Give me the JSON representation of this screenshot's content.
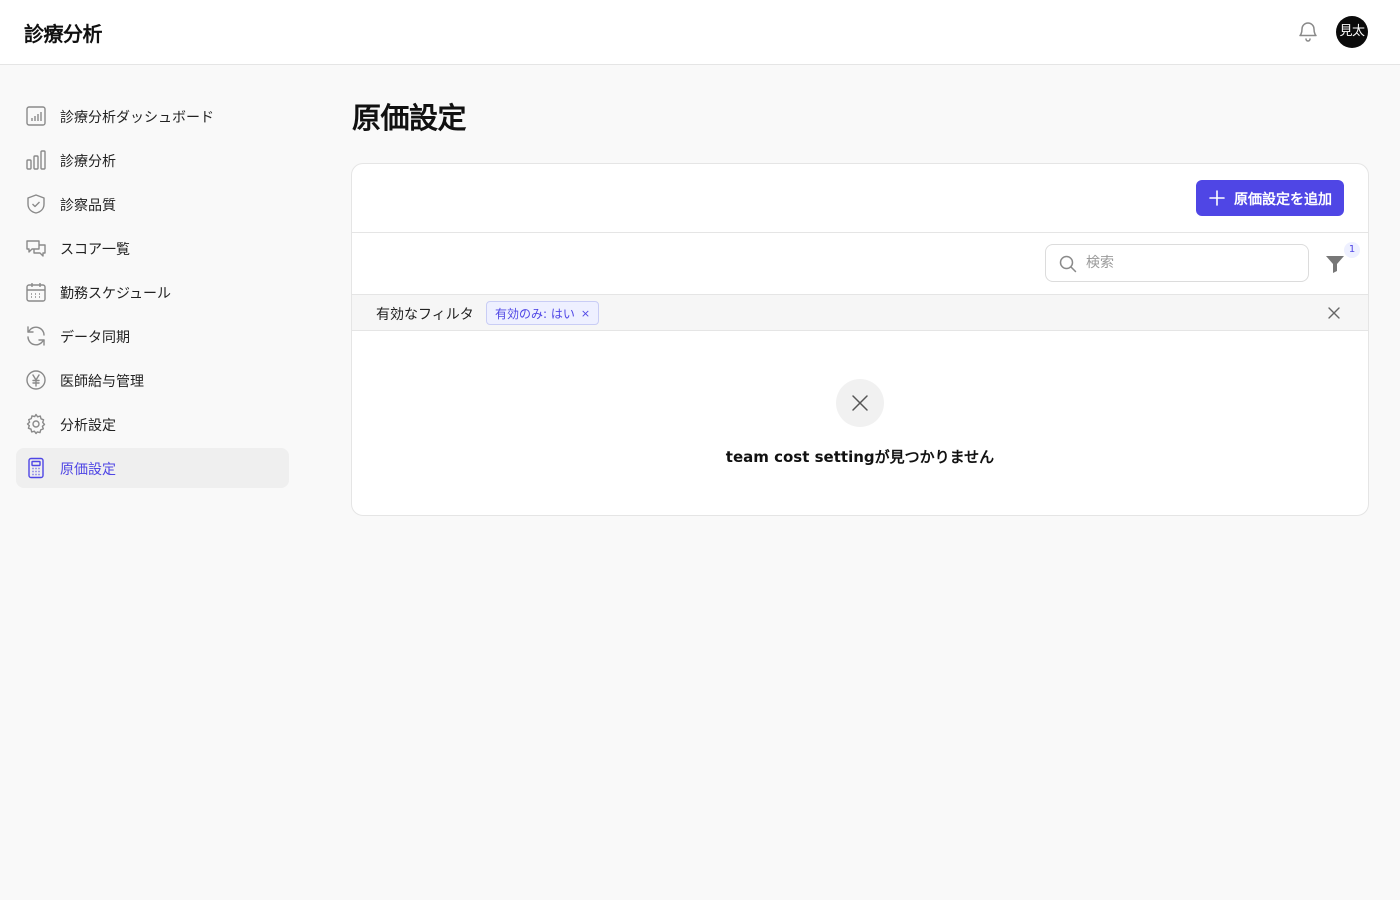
{
  "header": {
    "app_title": "診療分析",
    "avatar_initials": "見太"
  },
  "sidebar": {
    "items": [
      {
        "label": "診療分析ダッシュボード",
        "icon": "dashboard-chart-icon"
      },
      {
        "label": "診療分析",
        "icon": "bar-chart-icon"
      },
      {
        "label": "診察品質",
        "icon": "shield-check-icon"
      },
      {
        "label": "スコア一覧",
        "icon": "chat-bubbles-icon"
      },
      {
        "label": "勤務スケジュール",
        "icon": "calendar-icon"
      },
      {
        "label": "データ同期",
        "icon": "refresh-icon"
      },
      {
        "label": "医師給与管理",
        "icon": "yen-circle-icon"
      },
      {
        "label": "分析設定",
        "icon": "gear-icon"
      },
      {
        "label": "原価設定",
        "icon": "calculator-icon",
        "active": true
      }
    ]
  },
  "main": {
    "page_title": "原価設定",
    "add_button_label": "原価設定を追加",
    "search_placeholder": "検索",
    "filter_count": "1",
    "active_filters_label": "有効なフィルタ",
    "filter_chip": "有効のみ: はい",
    "chip_remove": "×",
    "empty_message": "team cost settingが見つかりません"
  },
  "colors": {
    "accent": "#4f46e5",
    "background": "#f9f9f9",
    "avatar_bg": "#0b0b0b"
  }
}
